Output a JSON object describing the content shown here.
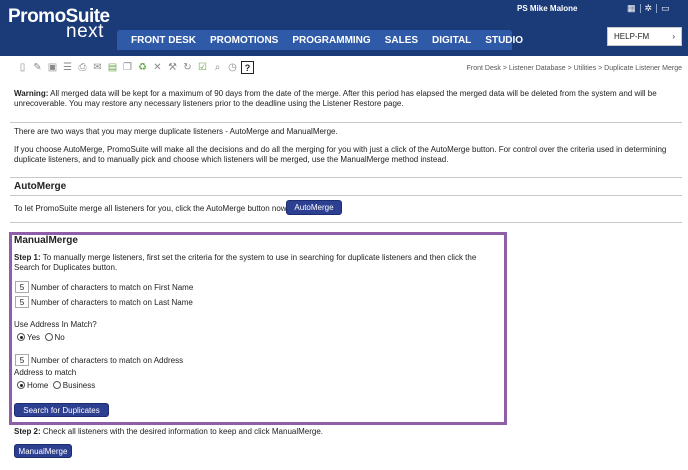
{
  "brand": {
    "name_bold": "PromoSuite",
    "name_light": "next"
  },
  "user": {
    "name": "PS Mike Malone"
  },
  "nav": [
    "FRONT DESK",
    "PROMOTIONS",
    "PROGRAMMING",
    "SALES",
    "DIGITAL",
    "STUDIO"
  ],
  "help": {
    "label": "HELP-FM",
    "chevron": "›"
  },
  "toolbar_icons": [
    "new-page-icon",
    "edit-icon",
    "save-icon",
    "list-icon",
    "print-icon",
    "email-icon",
    "excel-icon",
    "copy-icon",
    "recycle-icon",
    "delete-icon",
    "tools-icon",
    "refresh-icon",
    "checklist-icon",
    "search-icon",
    "history-icon",
    "help-icon"
  ],
  "breadcrumb": "Front Desk > Listener Database > Utilities > Duplicate Listener Merge",
  "warning": {
    "label": "Warning:",
    "text": " All merged data will be kept for a maximum of 90 days from the date of the merge. After this period has elapsed the merged data will be deleted from the system and will be unrecoverable. You may restore any necessary listeners prior to the deadline using the Listener Restore page."
  },
  "intro": "There are two ways that you may merge duplicate listeners - AutoMerge and ManualMerge.",
  "auto_desc": "If you choose AutoMerge, PromoSuite will make all the decisions and do all the merging for you with just a click of the AutoMerge button. For control over the criteria used in determining duplicate listeners, and to manually pick and choose which listeners will be merged, use the ManualMerge method instead.",
  "automerge": {
    "title": "AutoMerge",
    "text": "To let PromoSuite merge all listeners for you, click the AutoMerge button now.",
    "button": "AutoMerge"
  },
  "manualmerge": {
    "title": "ManualMerge",
    "step1_label": "Step 1:",
    "step1_text": " To manually merge listeners, first set the criteria for the system to use in searching for duplicate listeners and then click the Search for Duplicates button.",
    "first_name_value": "5",
    "first_name_label": "Number of characters to match on First Name",
    "last_name_value": "5",
    "last_name_label": "Number of characters to match on Last Name",
    "use_address_label": "Use Address In Match?",
    "yes_label": "Yes",
    "no_label": "No",
    "use_address_selected": "Yes",
    "address_value": "5",
    "address_label": "Number of characters to match on Address",
    "address_to_match_label": "Address to match",
    "home_label": "Home",
    "business_label": "Business",
    "address_selected": "Home",
    "search_button": "Search for Duplicates",
    "step2_label": "Step 2:",
    "step2_text": " Check all listeners with the desired information to keep and click ManualMerge.",
    "manualmerge_button": "ManualMerge"
  }
}
